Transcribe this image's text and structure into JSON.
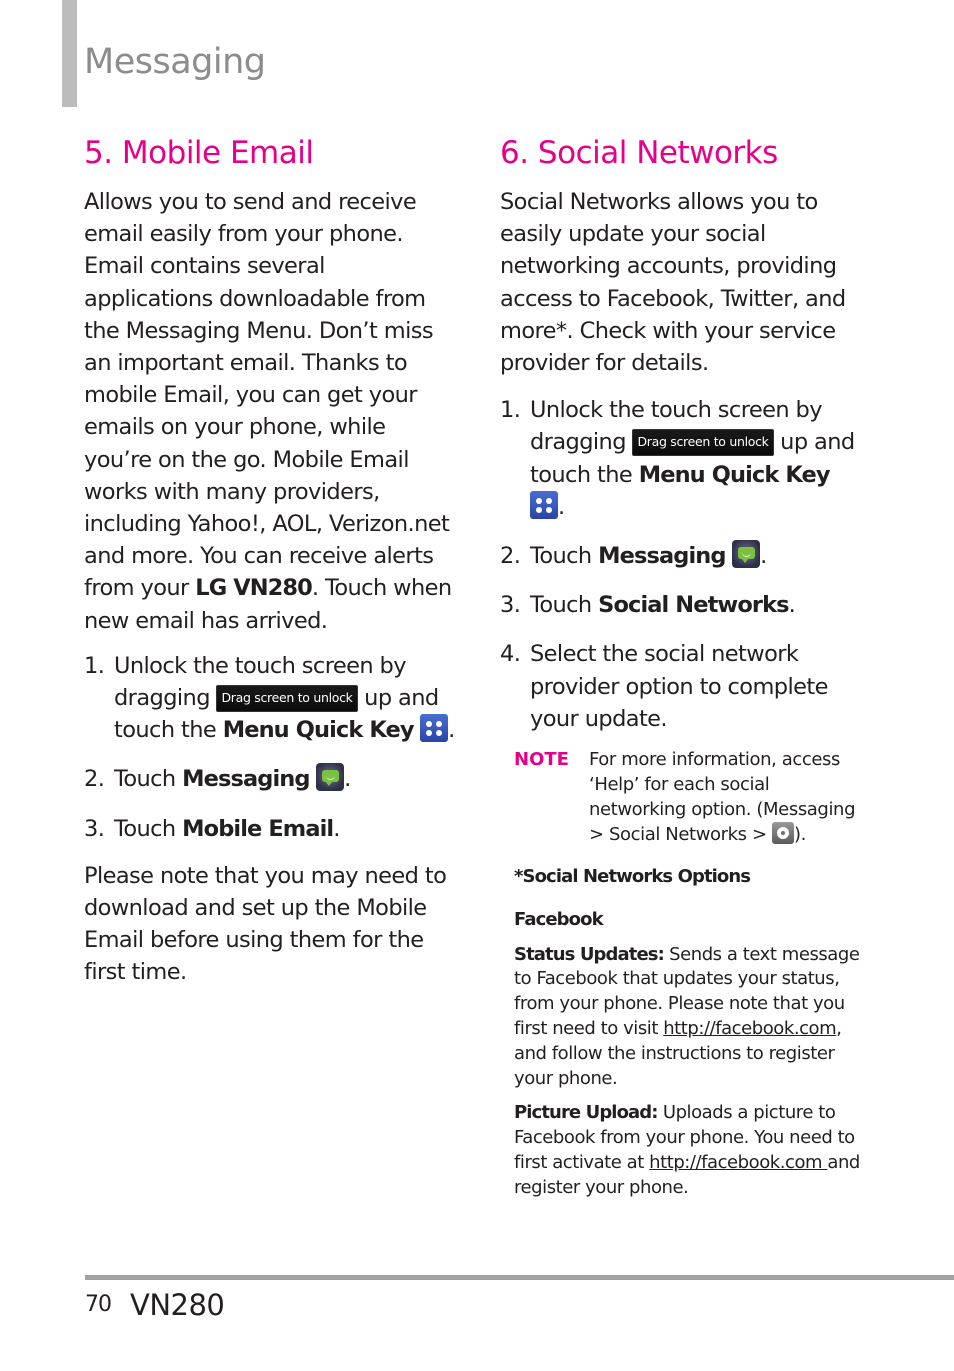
{
  "header": {
    "section_title": "Messaging"
  },
  "accent_color": "#e5008a",
  "mobile_email": {
    "title": "5. Mobile Email",
    "intro_prefix": "Allows you to send and receive email easily from your phone. Email contains several applications downloadable from the Messaging Menu. Don’t miss an important email. Thanks to mobile Email, you can get your emails on your phone, while you’re on the go. Mobile Email works with many providers, including Yahoo!, AOL, Verizon.net and more. You can receive alerts from your ",
    "intro_bold": "LG VN280",
    "intro_suffix": ". Touch when new email has arrived.",
    "steps": [
      {
        "num": "1.",
        "a": "Unlock the touch screen by dragging ",
        "chip": "Drag screen to unlock",
        "b": " up and touch the ",
        "bold": "Menu Quick Key",
        "icon": "menu-quick-key-icon",
        "end": "."
      },
      {
        "num": "2.",
        "a": "Touch ",
        "bold": "Messaging",
        "icon": "messaging-icon",
        "end": "."
      },
      {
        "num": "3.",
        "a": "Touch ",
        "bold": "Mobile Email",
        "end": "."
      }
    ],
    "closing": "Please note that you may need to download and set up the Mobile Email before using them for the first time."
  },
  "social_networks": {
    "title": "6. Social Networks",
    "intro": "Social Networks allows you to easily update your social networking accounts, providing access to Facebook, Twitter, and more*. Check with your service provider for details.",
    "steps": [
      {
        "num": "1.",
        "a": "Unlock the touch screen by dragging ",
        "chip": "Drag screen to unlock",
        "b": " up and touch the ",
        "bold": "Menu Quick Key",
        "icon": "menu-quick-key-icon",
        "end": "."
      },
      {
        "num": "2.",
        "a": "Touch ",
        "bold": "Messaging",
        "icon": "messaging-icon",
        "end": "."
      },
      {
        "num": "3.",
        "a": "Touch ",
        "bold": "Social Networks",
        "end": "."
      },
      {
        "num": "4.",
        "a": "Select the social network provider option to complete your update."
      }
    ],
    "note": {
      "label": "NOTE",
      "text_prefix": "For more information, access ‘Help’ for each social networking option. (Messaging > Social Networks > ",
      "icon": "settings-gear-icon",
      "text_suffix": ")."
    },
    "options_heading": "*Social Networks Options",
    "provider": "Facebook",
    "status_updates": {
      "label": "Status Updates:",
      "text_a": " Sends a text message to Facebook that updates your status, from your phone. Please note that you first need to visit ",
      "link": "http://facebook.com",
      "text_b": ", and follow the instructions to register your phone."
    },
    "picture_upload": {
      "label": "Picture Upload:",
      "text_a": " Uploads a picture to Facebook from your phone. You need to first activate at ",
      "link": "http://facebook.com ",
      "text_b": "and register your phone."
    }
  },
  "footer": {
    "page_number": "70",
    "model": "VN280"
  }
}
